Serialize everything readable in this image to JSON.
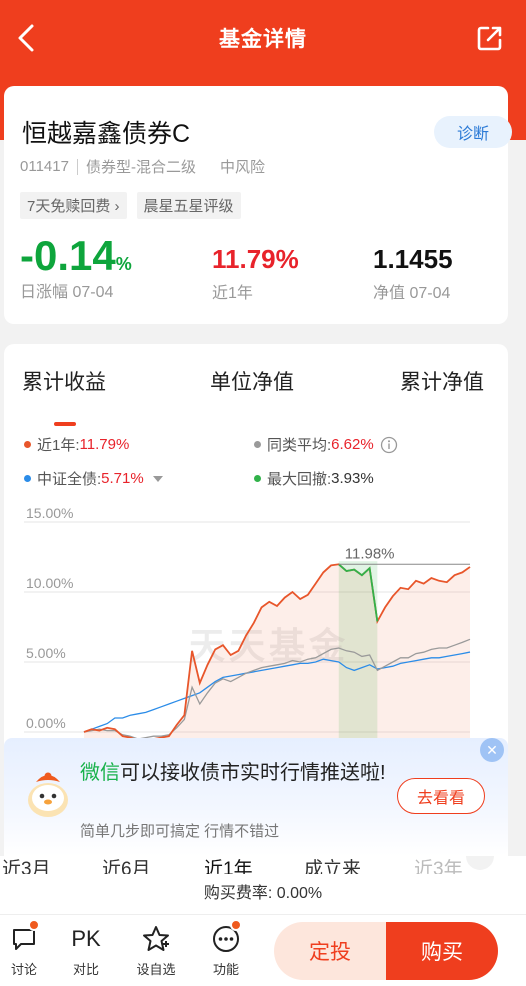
{
  "header": {
    "title": "基金详情"
  },
  "fund": {
    "name": "恒越嘉鑫债券C",
    "diagnose_label": "诊断",
    "code": "011417",
    "type": "债券型-混合二级",
    "risk": "中风险",
    "tags": [
      "7天免赎回费 ›",
      "晨星五星评级"
    ],
    "daily_change": "-0.14",
    "daily_change_unit": "%",
    "daily_change_label": "日涨幅 07-04",
    "year_return": "11.79%",
    "year_return_label": "近1年",
    "nav": "1.1455",
    "nav_label": "净值 07-04"
  },
  "chart_tabs": [
    "累计收益",
    "单位净值",
    "累计净值"
  ],
  "legend": [
    {
      "label": "近1年:",
      "value": "11.79%",
      "color": "#e8562b"
    },
    {
      "label": "同类平均:",
      "value": "6.62%",
      "color": "#9a9a9a"
    },
    {
      "label": "中证全债:",
      "value": "5.71%",
      "color": "#2b8ce8"
    },
    {
      "label": "最大回撤:",
      "value": "3.93%",
      "color": "#31b24a"
    }
  ],
  "info_icon": "info-icon",
  "chart_data": {
    "type": "line",
    "ylim": [
      0,
      15
    ],
    "yticks": [
      "15.00%",
      "10.00%",
      "5.00%",
      "0.00%"
    ],
    "annotation": "11.98%",
    "watermark": "天天基金",
    "colors": {
      "fund": "#e8562b",
      "peer": "#9a9a9a",
      "bond": "#2b8ce8",
      "drawdown": "#31b24a"
    },
    "x": [
      0,
      1,
      2,
      3,
      4,
      5,
      6,
      7,
      8,
      9,
      10,
      11,
      12,
      13,
      14,
      15,
      16,
      17,
      18,
      19,
      20,
      21,
      22,
      23,
      24,
      25,
      26,
      27,
      28,
      29,
      30,
      31,
      32,
      33,
      34,
      35,
      36,
      37,
      38,
      39,
      40,
      41,
      42,
      43,
      44,
      45,
      46,
      47,
      48,
      49,
      50
    ],
    "series": [
      {
        "name": "近1年",
        "values": [
          0,
          0.2,
          0.1,
          0.3,
          0.2,
          -0.3,
          -0.4,
          -0.6,
          -0.5,
          -0.5,
          -0.4,
          -0.3,
          0.5,
          1.2,
          5.8,
          3.5,
          4.8,
          5.9,
          6.2,
          5.5,
          5.8,
          6.9,
          7.8,
          8.9,
          9.3,
          9.0,
          9.6,
          10.0,
          9.5,
          9.8,
          10.6,
          11.4,
          11.9,
          11.98,
          11.5,
          11.6,
          11.2,
          11.7,
          7.9,
          8.9,
          9.7,
          10.3,
          10.2,
          10.8,
          10.6,
          11.0,
          10.8,
          10.7,
          11.2,
          11.4,
          11.79
        ]
      },
      {
        "name": "同类平均",
        "values": [
          0,
          0.1,
          0.2,
          0.1,
          0.1,
          -0.2,
          -0.3,
          -0.5,
          -0.4,
          -0.3,
          -0.3,
          -0.2,
          0.3,
          0.9,
          3.2,
          2.0,
          2.8,
          3.5,
          3.8,
          3.6,
          3.9,
          4.2,
          4.4,
          4.6,
          4.7,
          4.8,
          4.9,
          5.1,
          5.0,
          5.2,
          5.3,
          5.6,
          5.9,
          6.0,
          5.8,
          5.7,
          5.4,
          5.5,
          4.4,
          4.7,
          5.0,
          5.3,
          5.3,
          5.6,
          5.7,
          5.9,
          6.0,
          6.0,
          6.2,
          6.4,
          6.62
        ]
      },
      {
        "name": "中证全债",
        "values": [
          0,
          0.2,
          0.4,
          0.6,
          1.0,
          1.0,
          1.2,
          1.3,
          1.4,
          1.6,
          1.8,
          2.0,
          2.2,
          2.4,
          2.6,
          2.8,
          3.2,
          3.6,
          3.9,
          4.0,
          4.1,
          4.2,
          4.3,
          4.4,
          4.5,
          4.6,
          4.7,
          4.8,
          4.9,
          4.9,
          5.0,
          5.2,
          5.1,
          5.0,
          4.6,
          4.4,
          4.6,
          4.8,
          4.5,
          4.6,
          4.7,
          4.9,
          5.0,
          5.1,
          5.2,
          5.3,
          5.3,
          5.4,
          5.5,
          5.6,
          5.71
        ]
      }
    ],
    "drawdown_range": [
      33,
      38
    ]
  },
  "popup": {
    "highlight": "微信",
    "message": "可以接收债市实时行情推送啦!",
    "sub": "简单几步即可搞定 行情不错过",
    "button": "去看看",
    "close": "✕"
  },
  "periods": [
    "近3月",
    "近6月",
    "近1年",
    "成立来",
    "近3年"
  ],
  "fee": "购买费率: 0.00%",
  "bottom_nav": [
    {
      "label": "讨论",
      "icon": "chat-icon"
    },
    {
      "label": "对比",
      "icon": "pk-icon",
      "text": "PK"
    },
    {
      "label": "设自选",
      "icon": "star-icon"
    },
    {
      "label": "功能",
      "icon": "more-icon"
    }
  ],
  "actions": {
    "dingtou": "定投",
    "buy": "购买"
  }
}
